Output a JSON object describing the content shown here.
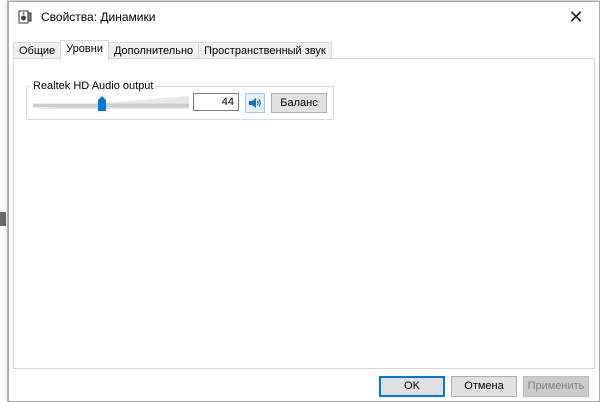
{
  "window": {
    "title": "Свойства: Динамики",
    "close_glyph": "✕"
  },
  "tabs": [
    {
      "label": "Общие",
      "active": false
    },
    {
      "label": "Уровни",
      "active": true
    },
    {
      "label": "Дополнительно",
      "active": false
    },
    {
      "label": "Пространственный звук",
      "active": false
    }
  ],
  "levels": {
    "device_label": "Realtek HD Audio output",
    "volume": 44,
    "volume_text": "44",
    "speaker_icon": "speaker-icon",
    "balance_label": "Баланс"
  },
  "footer": {
    "ok_label": "OK",
    "cancel_label": "Отмена",
    "apply_label": "Применить"
  },
  "colors": {
    "accent": "#0078d7",
    "slider_thumb": "#0078d7"
  }
}
